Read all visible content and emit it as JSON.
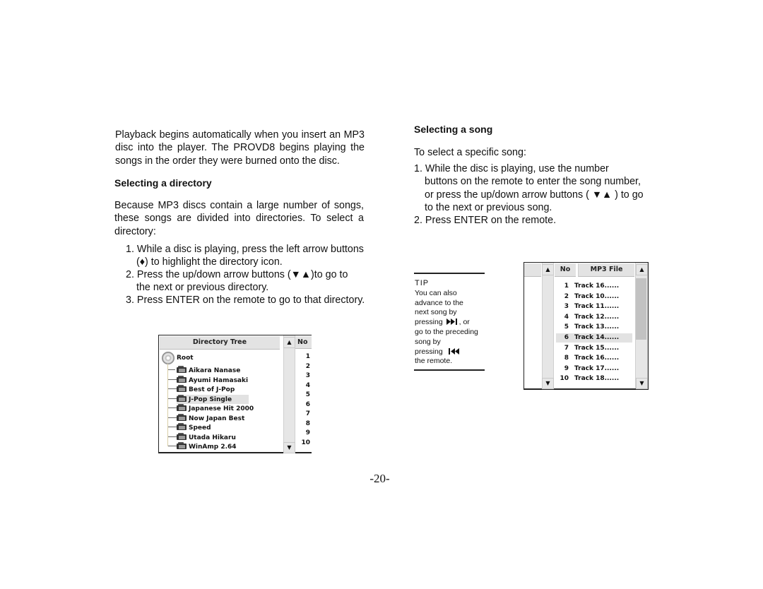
{
  "page_number": "-20-",
  "left": {
    "intro": "Playback begins automatically when you insert an MP3 disc into the player.  The PROVD8 begins playing the songs in the order they were burned onto the disc.",
    "heading": "Selecting a directory",
    "body": "Because MP3 discs contain a large number of  songs, these songs are divided into directories. To select a directory:",
    "steps": [
      {
        "num": "1.",
        "line1": "While a disc is playing, press the left  arrow buttons",
        "line2": "(♦) to highlight  the directory  icon."
      },
      {
        "num": "2.",
        "line1": "Press the up/down arrow buttons (▼▲)to go to",
        "line2": "the next or previous directory."
      },
      {
        "num": "3.",
        "line1": "Press ENTER on the remote to go to that directory."
      }
    ]
  },
  "right": {
    "heading": "Selecting a song",
    "intro": "To select a specific song:",
    "steps": [
      {
        "num": "1.",
        "lines": [
          "While the disc is playing, use the number",
          "buttons on the remote to enter the song number,",
          "or press the up/down arrow buttons ( ▼▲ ) to go",
          "to the next or previous song."
        ]
      },
      {
        "num": "2.",
        "lines": [
          "Press ENTER on the remote."
        ]
      }
    ]
  },
  "tip": {
    "title": "TIP",
    "lines": [
      "You can also",
      "advance to the",
      "next song by",
      "pressing",
      ", or",
      "go to the preceding",
      "song by",
      "pressing",
      "the remote."
    ],
    "next_icon": "next-track-icon",
    "prev_icon": "previous-track-icon"
  },
  "directory_tree": {
    "header": "Directory Tree",
    "number_header": "No",
    "root": "Root",
    "items": [
      "Aikara Nanase",
      "Ayumi Hamasaki",
      "Best of J-Pop",
      "J-Pop Single",
      "Japanese Hit 2000",
      "Now Japan Best",
      "Speed",
      "Utada Hikaru",
      "WinAmp 2.64"
    ],
    "selected_index": 3,
    "numbers": [
      "1",
      "2",
      "3",
      "4",
      "5",
      "6",
      "7",
      "8",
      "9",
      "10"
    ],
    "scroll_up": "▲",
    "scroll_down": "▼"
  },
  "mp3_list": {
    "col_no": "No",
    "col_file": "MP3 File",
    "rows": [
      {
        "no": "1",
        "file": "Track 16......"
      },
      {
        "no": "2",
        "file": "Track 10......"
      },
      {
        "no": "3",
        "file": "Track 11......"
      },
      {
        "no": "4",
        "file": "Track 12......"
      },
      {
        "no": "5",
        "file": "Track 13......"
      },
      {
        "no": "6",
        "file": "Track 14......"
      },
      {
        "no": "7",
        "file": "Track 15......"
      },
      {
        "no": "8",
        "file": "Track 16......"
      },
      {
        "no": "9",
        "file": "Track 17......"
      },
      {
        "no": "10",
        "file": "Track 18......"
      }
    ],
    "selected_index": 5,
    "scroll_up": "▲",
    "scroll_down": "▼"
  }
}
